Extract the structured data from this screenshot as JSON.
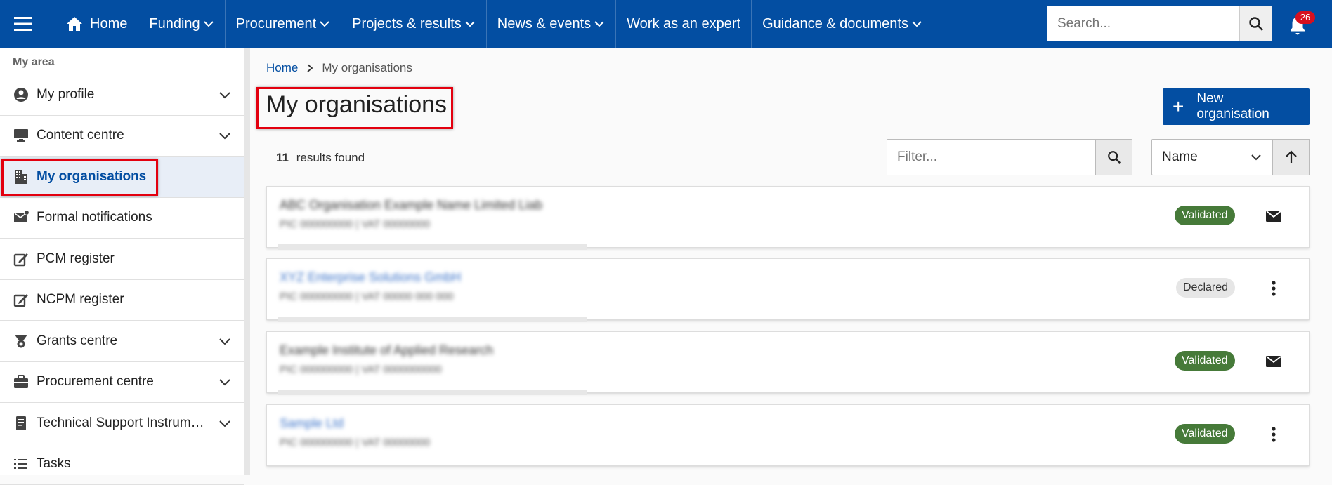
{
  "topnav": {
    "home": "Home",
    "items": [
      "Funding",
      "Procurement",
      "Projects & results",
      "News & events",
      "Work as an expert",
      "Guidance & documents"
    ],
    "search_placeholder": "Search...",
    "notification_count": "26",
    "brand_color": "#034ea2"
  },
  "sidebar": {
    "heading": "My area",
    "items": [
      {
        "label": "My profile",
        "icon": "user-circle-icon",
        "expandable": true
      },
      {
        "label": "Content centre",
        "icon": "monitor-icon",
        "expandable": true
      },
      {
        "label": "My organisations",
        "icon": "building-icon",
        "expandable": false,
        "active": true
      },
      {
        "label": "Formal notifications",
        "icon": "mail-notification-icon",
        "expandable": false
      },
      {
        "label": "PCM register",
        "icon": "edit-box-icon",
        "expandable": false
      },
      {
        "label": "NCPM register",
        "icon": "edit-box-icon",
        "expandable": false
      },
      {
        "label": "Grants centre",
        "icon": "medal-icon",
        "expandable": true
      },
      {
        "label": "Procurement centre",
        "icon": "briefcase-icon",
        "expandable": true
      },
      {
        "label": "Technical Support Instrum…",
        "icon": "document-icon",
        "expandable": true
      },
      {
        "label": "Tasks",
        "icon": "list-icon",
        "expandable": false
      }
    ]
  },
  "breadcrumb": {
    "home": "Home",
    "current": "My organisations"
  },
  "page": {
    "title": "My organisations",
    "new_button": "New organisation",
    "results_count": "11",
    "results_label": "results found",
    "filter_placeholder": "Filter...",
    "sort_value": "Name"
  },
  "organisations": [
    {
      "name": "ABC Organisation Example Name Limited Liab",
      "sub": "PIC 000000000 | VAT 00000000",
      "status": "Validated",
      "action": "mail",
      "link": false
    },
    {
      "name": "XYZ Enterprise Solutions GmbH",
      "sub": "PIC 000000000 | VAT 00000 000 000",
      "status": "Declared",
      "action": "more",
      "link": true
    },
    {
      "name": "Example Institute of Applied Research",
      "sub": "PIC 000000000 | VAT 0000000000",
      "status": "Validated",
      "action": "mail",
      "link": false
    },
    {
      "name": "Sample Ltd",
      "sub": "PIC 000000000 | VAT 00000000",
      "status": "Validated",
      "action": "more",
      "link": true
    }
  ],
  "colors": {
    "validated": "#467a39",
    "declared": "#e6e6e6",
    "highlight": "#e3000f"
  }
}
